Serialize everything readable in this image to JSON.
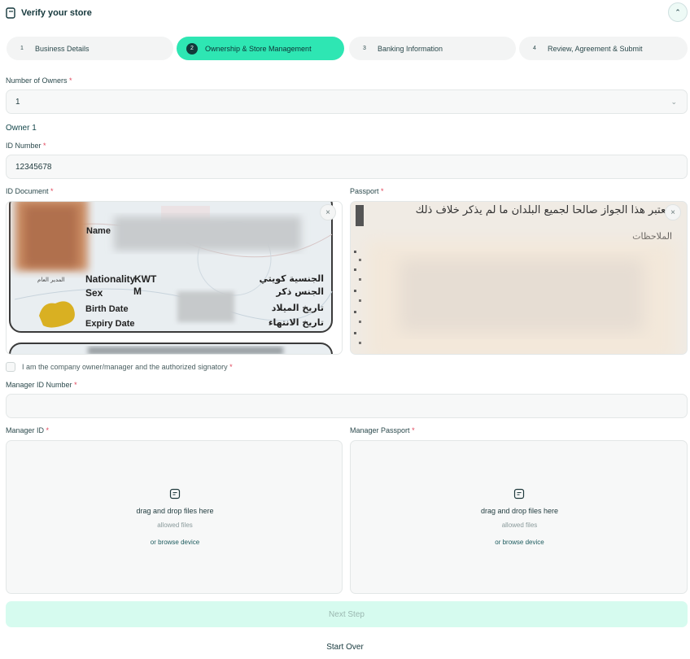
{
  "header": {
    "title": "Verify your store",
    "collapse_icon": "chevron-up-icon"
  },
  "steps": [
    {
      "number": "1",
      "label": "Business Details",
      "active": false
    },
    {
      "number": "2",
      "label": "Ownership & Store Management",
      "active": true
    },
    {
      "number": "3",
      "label": "Banking Information",
      "active": false
    },
    {
      "number": "4",
      "label": "Review, Agreement & Submit",
      "active": false
    }
  ],
  "owners": {
    "label": "Number of Owners",
    "value": "1"
  },
  "owner1": {
    "title": "Owner 1",
    "id_number_label": "ID Number",
    "id_number_value": "12345678",
    "id_document_label": "ID Document",
    "passport_label": "Passport",
    "id_card_text": {
      "name": "Name",
      "nationality": "Nationality",
      "nationality_value": "KWT",
      "sex": "Sex",
      "sex_value": "M",
      "birth_date": "Birth Date",
      "expiry_date": "Expiry Date",
      "ar_nationality": "الجنسية كويتي",
      "ar_sex": "الجنس ذكر",
      "ar_birth": "تاريخ الميلاد",
      "ar_expiry": "تاريخ الانتهاء",
      "ar_director": "المدير العام"
    },
    "passport_text": {
      "line1": "يعتبر هذا الجواز صالحا لجميع البلدان ما لم يذكر خلاف ذلك.",
      "line2": "الملاحظات"
    }
  },
  "signatory": {
    "label": "I am the company owner/manager and the authorized signatory"
  },
  "manager": {
    "id_number_label": "Manager ID Number",
    "id_number_value": "",
    "id_label": "Manager ID",
    "passport_label": "Manager Passport"
  },
  "dropzone": {
    "title": "drag and drop files here",
    "subtitle": "allowed files",
    "link": "or browse device"
  },
  "required_mark": "*",
  "close_symbol": "×",
  "chevron_down": "⌄",
  "chevron_up": "⌃",
  "actions": {
    "next": "Next Step",
    "start_over": "Start Over"
  },
  "colors": {
    "accent": "#2ee6b3",
    "next_disabled_bg": "#d6fbef",
    "required": "#e0455a",
    "dark_text": "#14373b"
  }
}
